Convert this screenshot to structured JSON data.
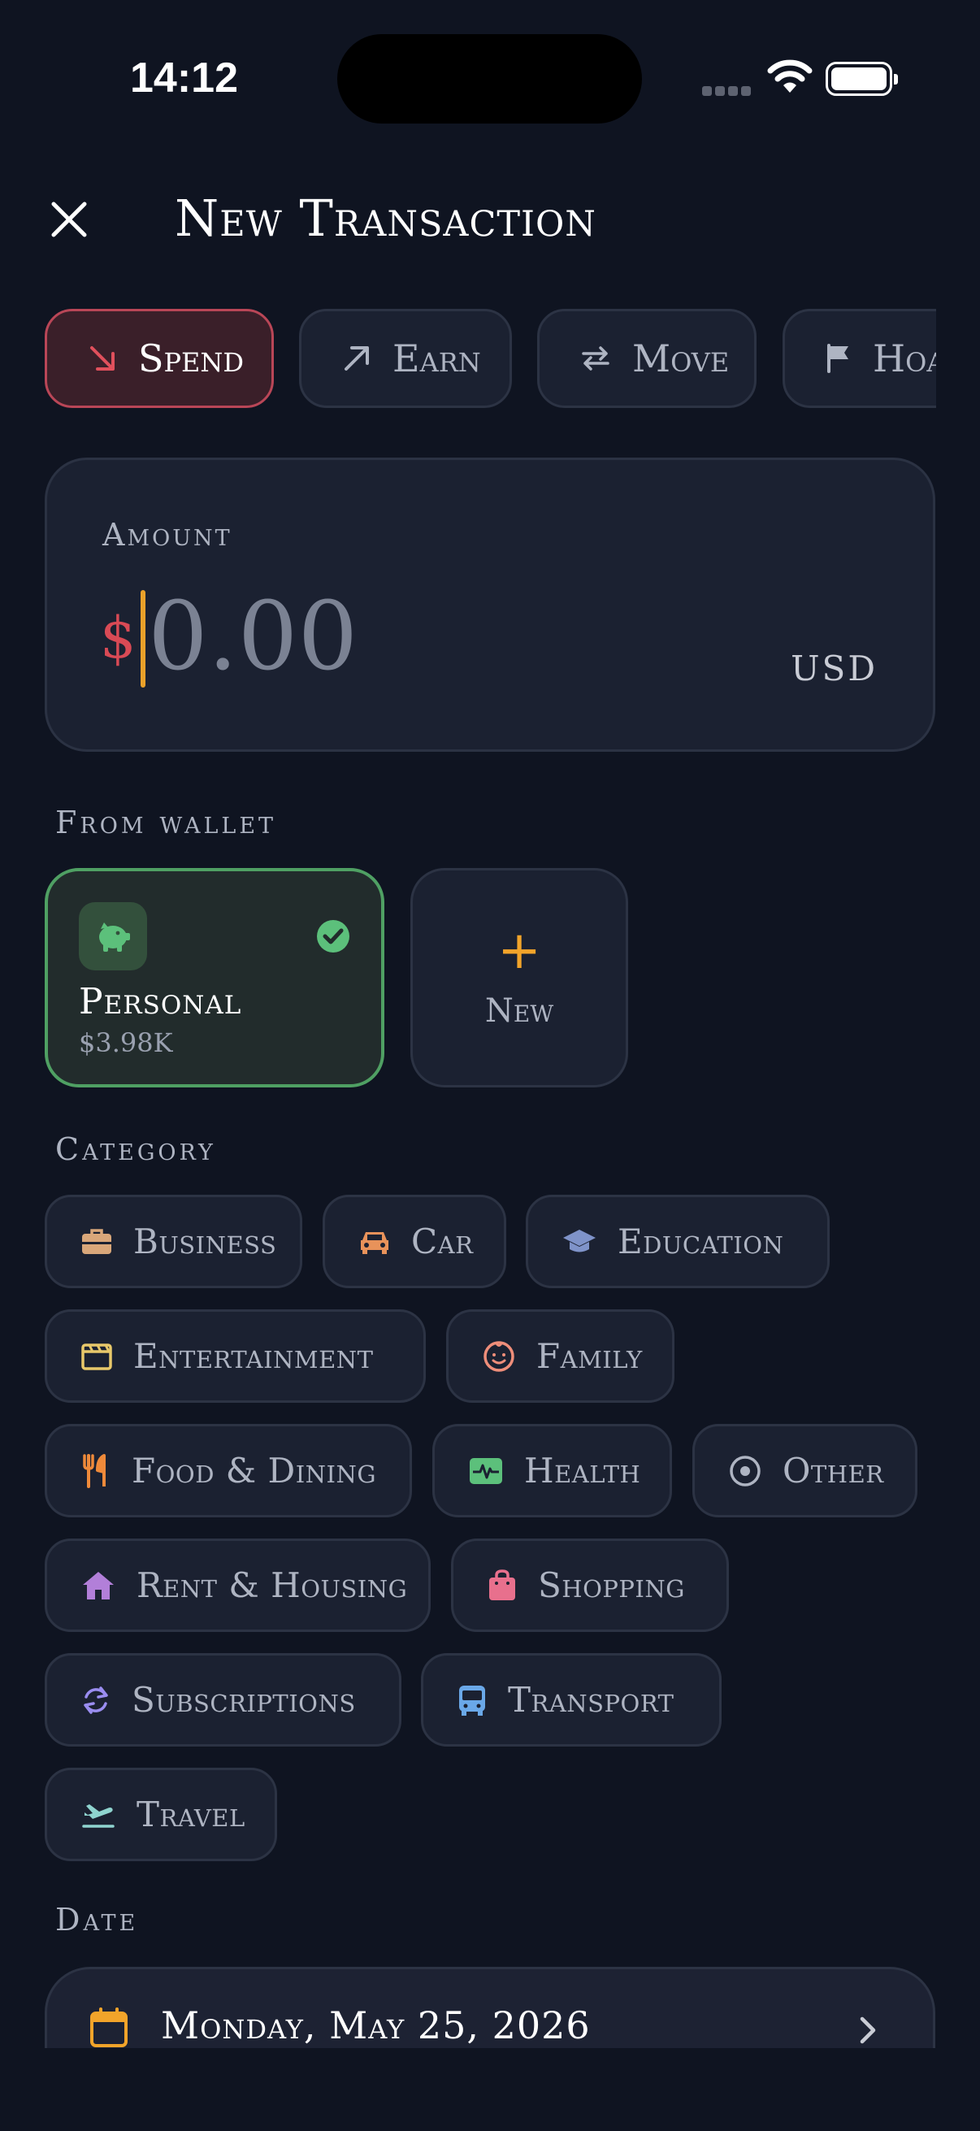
{
  "status": {
    "time": "14:12"
  },
  "header": {
    "title": "New Transaction"
  },
  "type_tabs": [
    {
      "label": "Spend",
      "icon": "arrow-down-right-icon",
      "active": true
    },
    {
      "label": "Earn",
      "icon": "arrow-up-right-icon",
      "active": false
    },
    {
      "label": "Move",
      "icon": "arrows-swap-icon",
      "active": false
    },
    {
      "label": "Hoard",
      "icon": "flag-icon",
      "active": false
    }
  ],
  "amount": {
    "label": "Amount",
    "symbol": "$",
    "placeholder": "0.00",
    "value": "",
    "currency": "USD"
  },
  "wallet": {
    "section_label": "From wallet",
    "items": [
      {
        "name": "Personal",
        "balance": "$3.98K",
        "icon": "piggy-bank-icon",
        "selected": true
      }
    ],
    "new_label": "New"
  },
  "category": {
    "section_label": "Category",
    "items": [
      {
        "label": "Business",
        "icon": "briefcase-icon",
        "color": "#d9a77a"
      },
      {
        "label": "Car",
        "icon": "car-icon",
        "color": "#e8925a"
      },
      {
        "label": "Education",
        "icon": "graduation-cap-icon",
        "color": "#7f93c9"
      },
      {
        "label": "Entertainment",
        "icon": "clapperboard-icon",
        "color": "#e8c86a"
      },
      {
        "label": "Family",
        "icon": "baby-face-icon",
        "color": "#ef8e7a"
      },
      {
        "label": "Food & Dining",
        "icon": "utensils-icon",
        "color": "#ef8a3a"
      },
      {
        "label": "Health",
        "icon": "heart-pulse-icon",
        "color": "#5cc07b"
      },
      {
        "label": "Other",
        "icon": "circle-dot-icon",
        "color": "#aeb4c2"
      },
      {
        "label": "Rent & Housing",
        "icon": "house-icon",
        "color": "#b27fd9"
      },
      {
        "label": "Shopping",
        "icon": "shopping-bag-icon",
        "color": "#e8708d"
      },
      {
        "label": "Subscriptions",
        "icon": "refresh-icon",
        "color": "#9a8df0"
      },
      {
        "label": "Transport",
        "icon": "bus-icon",
        "color": "#6aa8e8"
      },
      {
        "label": "Travel",
        "icon": "plane-icon",
        "color": "#8fd4cf"
      }
    ]
  },
  "date": {
    "section_label": "Date",
    "value": "Monday, May 25, 2026"
  },
  "colors": {
    "background": "#0f1421",
    "card": "#1b2131",
    "spend_accent": "#d94a55",
    "wallet_accent": "#4fa063",
    "caret": "#eaa12a"
  }
}
